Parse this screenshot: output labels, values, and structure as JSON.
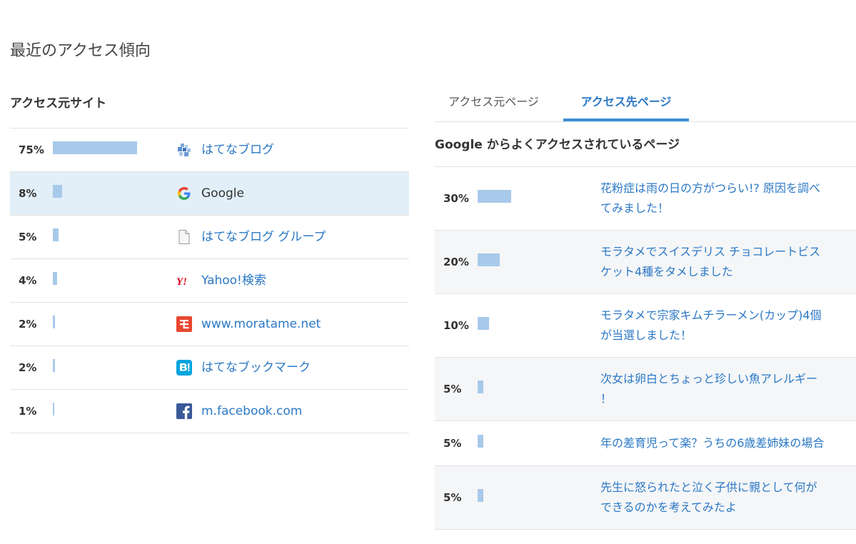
{
  "page_title": "最近のアクセス傾向",
  "referrer_sites": {
    "title": "アクセス元サイト",
    "items": [
      {
        "percent": "75%",
        "value": 75,
        "name": "はてなブログ",
        "icon": "hatena-blog-icon"
      },
      {
        "percent": "8%",
        "value": 8,
        "name": "Google",
        "icon": "google-icon"
      },
      {
        "percent": "5%",
        "value": 5,
        "name": "はてなブログ グループ",
        "icon": "document-icon"
      },
      {
        "percent": "4%",
        "value": 4,
        "name": "Yahoo!検索",
        "icon": "yahoo-icon"
      },
      {
        "percent": "2%",
        "value": 2,
        "name": "www.moratame.net",
        "icon": "moratame-icon"
      },
      {
        "percent": "2%",
        "value": 2,
        "name": "はてなブックマーク",
        "icon": "hatena-bookmark-icon"
      },
      {
        "percent": "1%",
        "value": 1,
        "name": "m.facebook.com",
        "icon": "facebook-icon"
      }
    ]
  },
  "tabs": [
    {
      "label": "アクセス元ページ",
      "active": false
    },
    {
      "label": "アクセス先ページ",
      "active": true
    }
  ],
  "google_pages": {
    "title": "Google からよくアクセスされているページ",
    "items": [
      {
        "percent": "30%",
        "value": 30,
        "lines": [
          "花粉症は雨の日の方がつらい!? 原因を調べ",
          "てみました！"
        ]
      },
      {
        "percent": "20%",
        "value": 20,
        "lines": [
          "モラタメでスイスデリス チョコレートビス",
          "ケット4種をタメしました"
        ]
      },
      {
        "percent": "10%",
        "value": 10,
        "lines": [
          "モラタメで宗家キムチラーメン(カップ)4個",
          "が当選しました！"
        ]
      },
      {
        "percent": "5%",
        "value": 5,
        "lines": [
          "次女は卵白とちょっと珍しい魚アレルギー",
          "！"
        ]
      },
      {
        "percent": "5%",
        "value": 5,
        "lines": [
          "年の差育児って楽？うちの6歳差姉妹の場合"
        ]
      },
      {
        "percent": "5%",
        "value": 5,
        "lines": [
          "先生に怒られたと泣く子供に親として何が",
          "できるのかを考えてみたよ"
        ]
      }
    ]
  },
  "colors": {
    "bar": "#a8c9ea",
    "link": "#2b78c5",
    "highlight_row": "#e2eff8"
  }
}
